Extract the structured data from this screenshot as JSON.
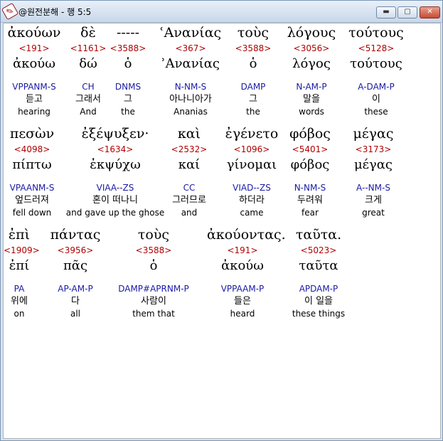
{
  "window": {
    "title": "@원전분해 - 행 5:5",
    "minimize_label": "▬",
    "maximize_label": "▢",
    "close_label": "✕"
  },
  "lines": [
    [
      {
        "greek": "ἀκούων",
        "strong": "<191>",
        "lemma": "ἀκούω",
        "parse": "VPPANM-S",
        "korean": "듣고",
        "english": "hearing"
      },
      {
        "greek": "δὲ",
        "strong": "<1161>",
        "lemma": "δώ",
        "parse": "CH",
        "korean": "그래서",
        "english": "And"
      },
      {
        "greek": "-----",
        "strong": "<3588>",
        "lemma": "ὁ",
        "parse": "DNMS",
        "korean": "그",
        "english": "the"
      },
      {
        "greek": "ʿΑνανίας",
        "strong": "<367>",
        "lemma": "ʾΑνανίας",
        "parse": "N-NM-S",
        "korean": "아나니아가",
        "english": "Ananias"
      },
      {
        "greek": "τοὺς",
        "strong": "<3588>",
        "lemma": "ὁ",
        "parse": "DAMP",
        "korean": "그",
        "english": "the"
      },
      {
        "greek": "λόγους",
        "strong": "<3056>",
        "lemma": "λόγος",
        "parse": "N-AM-P",
        "korean": "말을",
        "english": "words"
      },
      {
        "greek": "τούτους",
        "strong": "<5128>",
        "lemma": "τούτους",
        "parse": "A-DAM-P",
        "korean": "이",
        "english": "these"
      }
    ],
    [
      {
        "greek": "πεσὼν",
        "strong": "<4098>",
        "lemma": "πίπτω",
        "parse": "VPAANM-S",
        "korean": "엎드러져",
        "english": "fell down"
      },
      {
        "greek": "ἐξέψυξεν·",
        "strong": "<1634>",
        "lemma": "ἐκψύχω",
        "parse": "VIAA--ZS",
        "korean": "혼이 떠나니",
        "english": "and gave up the ghose"
      },
      {
        "greek": "καὶ",
        "strong": "<2532>",
        "lemma": "καί",
        "parse": "CC",
        "korean": "그러므로",
        "english": "and"
      },
      {
        "greek": "ἐγένετο",
        "strong": "<1096>",
        "lemma": "γίνομαι",
        "parse": "VIAD--ZS",
        "korean": "하더라",
        "english": "came"
      },
      {
        "greek": "φόβος",
        "strong": "<5401>",
        "lemma": "φόβος",
        "parse": "N-NM-S",
        "korean": "두려워",
        "english": "fear"
      },
      {
        "greek": "μέγας",
        "strong": "<3173>",
        "lemma": "μέγας",
        "parse": "A--NM-S",
        "korean": "크게",
        "english": "great"
      }
    ],
    [
      {
        "greek": "ἐπὶ",
        "strong": "<1909>",
        "lemma": "ἐπί",
        "parse": "PA",
        "korean": "위에",
        "english": "on"
      },
      {
        "greek": "πάντας",
        "strong": "<3956>",
        "lemma": "πᾶς",
        "parse": "AP-AM-P",
        "korean": "다",
        "english": "all"
      },
      {
        "greek": "τοὺς",
        "strong": "<3588>",
        "lemma": "ὁ",
        "parse": "DAMP#APRNM-P",
        "korean": "사람이",
        "english": "them that"
      },
      {
        "greek": "ἀκούοντας.",
        "strong": "<191>",
        "lemma": "ἀκούω",
        "parse": "VPPAAM-P",
        "korean": "들은",
        "english": "heard"
      },
      {
        "greek": "ταῦτα.",
        "strong": "<5023>",
        "lemma": "ταῦτα",
        "parse": "APDAM-P",
        "korean": "이 일을",
        "english": "these things"
      }
    ]
  ],
  "colors": {
    "strong": "#b00000",
    "parse": "#1a1aa6",
    "text": "#000000",
    "background": "#ffffff"
  }
}
